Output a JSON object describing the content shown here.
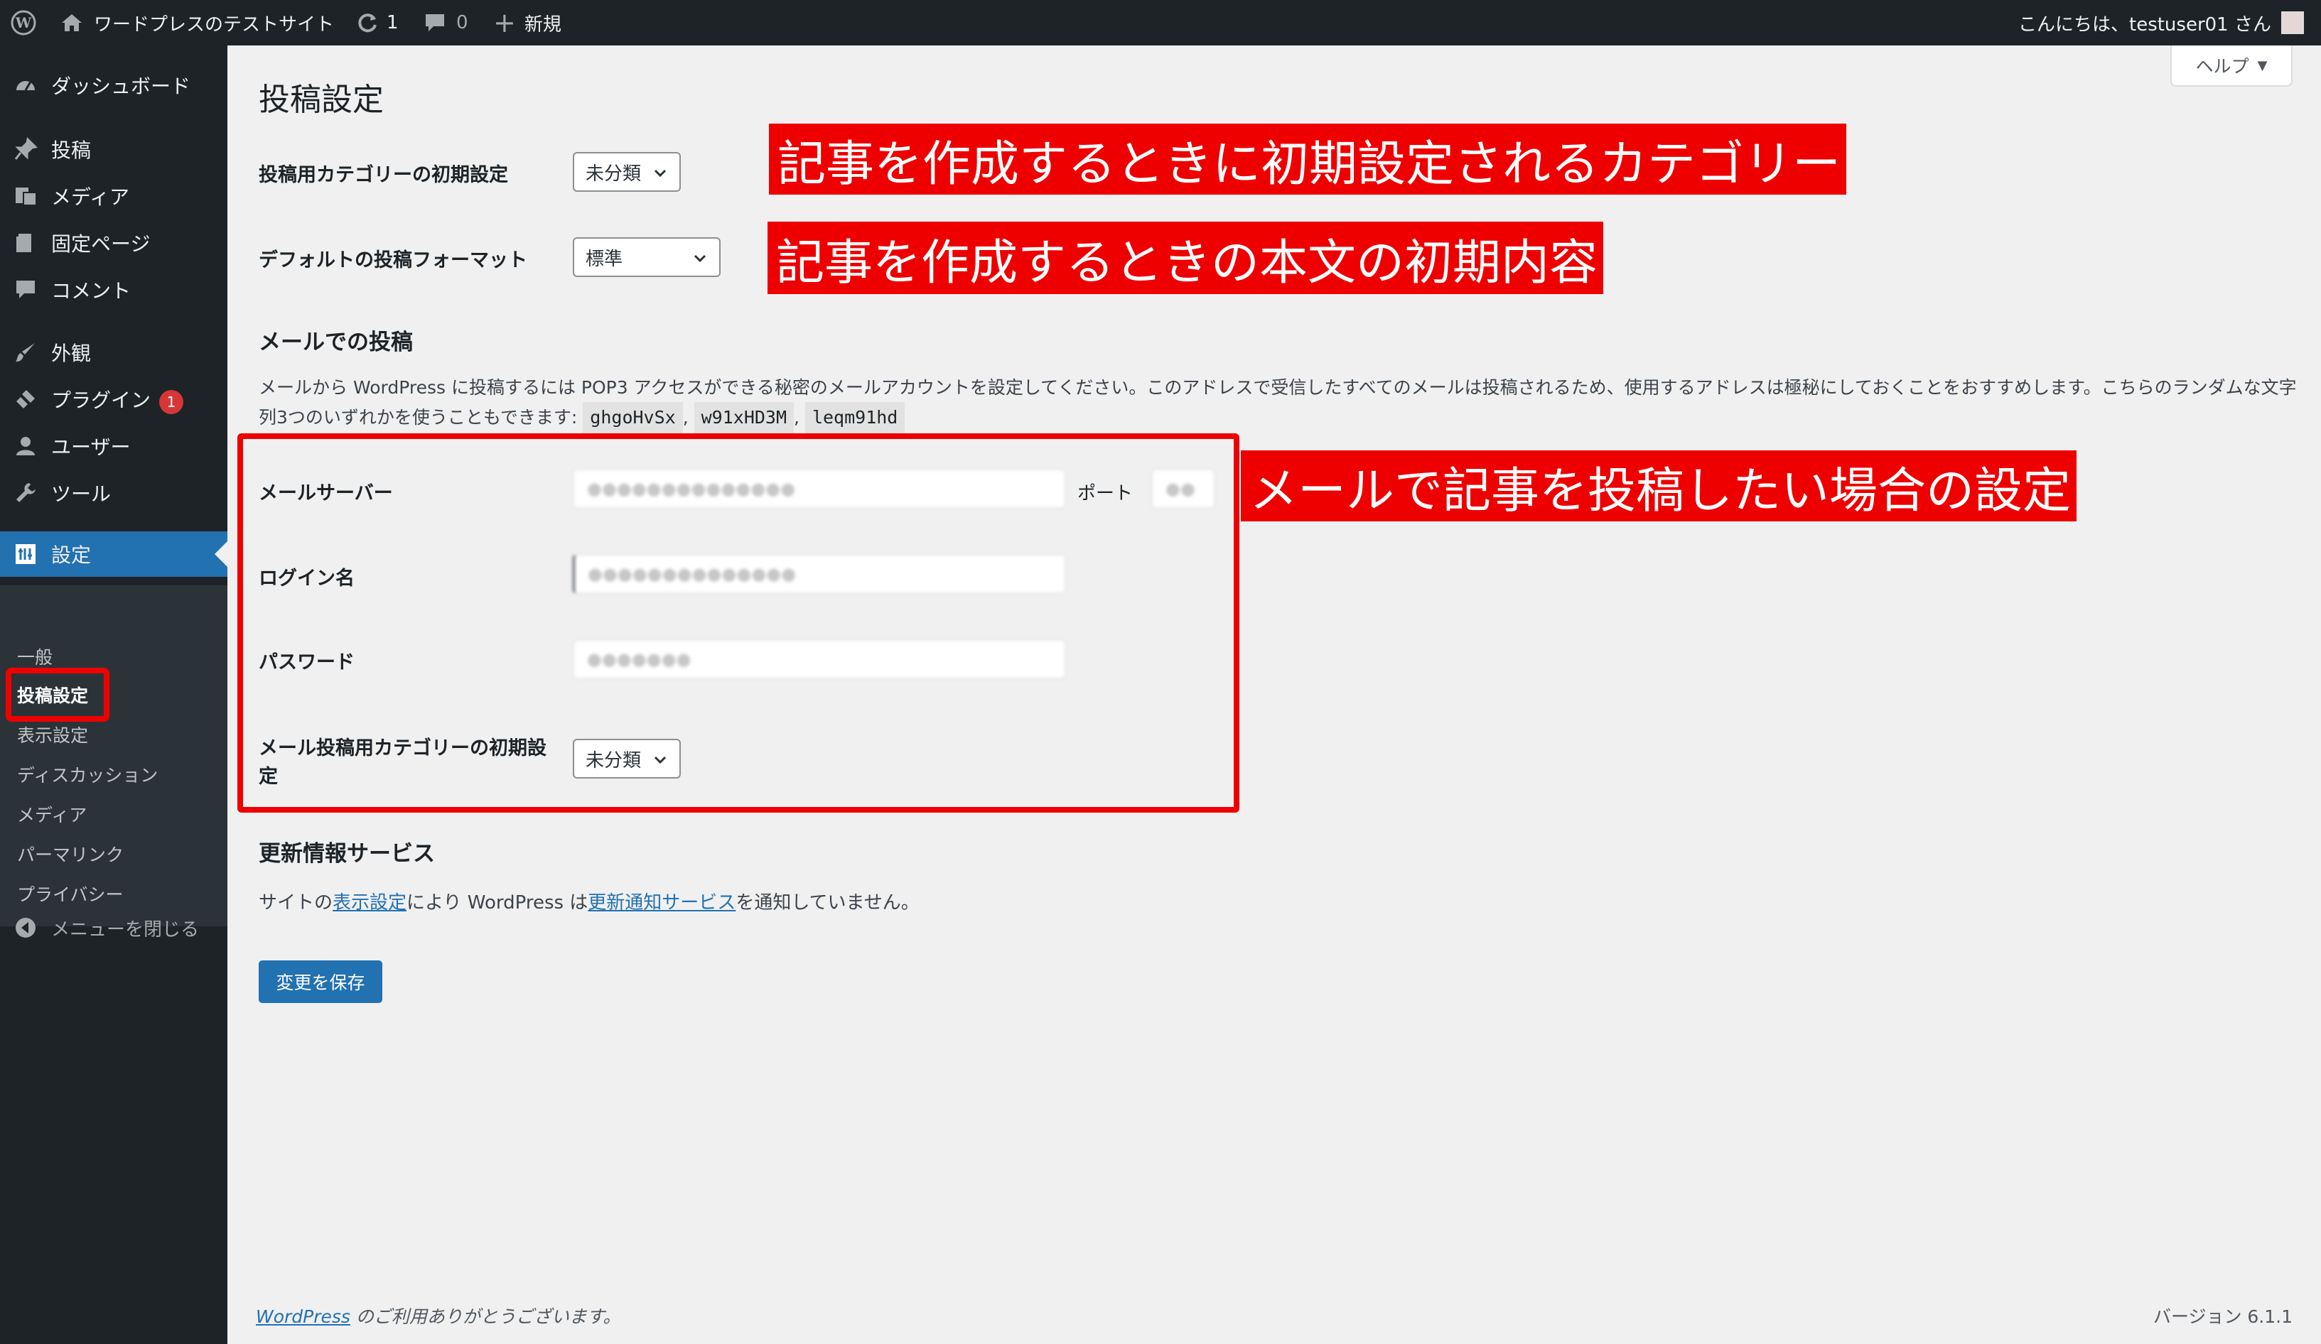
{
  "admin_bar": {
    "site_name": "ワードプレスのテストサイト",
    "updates_count": "1",
    "comments_count": "0",
    "new_label": "新規",
    "greeting": "こんにちは、testuser01 さん"
  },
  "sidebar": {
    "items": [
      {
        "label": "ダッシュボード",
        "icon": "dashboard-icon"
      },
      {
        "label": "投稿",
        "icon": "pin-icon"
      },
      {
        "label": "メディア",
        "icon": "media-icon"
      },
      {
        "label": "固定ページ",
        "icon": "page-icon"
      },
      {
        "label": "コメント",
        "icon": "comment-icon"
      },
      {
        "label": "外観",
        "icon": "brush-icon"
      },
      {
        "label": "プラグイン",
        "icon": "plugin-icon",
        "badge": "1"
      },
      {
        "label": "ユーザー",
        "icon": "user-icon"
      },
      {
        "label": "ツール",
        "icon": "wrench-icon"
      },
      {
        "label": "設定",
        "icon": "settings-icon",
        "current": true
      }
    ],
    "submenu": [
      "一般",
      "投稿設定",
      "表示設定",
      "ディスカッション",
      "メディア",
      "パーマリンク",
      "プライバシー"
    ],
    "submenu_current": "投稿設定",
    "collapse_label": "メニューを閉じる"
  },
  "help_label": "ヘルプ",
  "page": {
    "title": "投稿設定",
    "default_category_label": "投稿用カテゴリーの初期設定",
    "default_category_value": "未分類",
    "default_format_label": "デフォルトの投稿フォーマット",
    "default_format_value": "標準",
    "post_via_email_heading": "メールでの投稿",
    "post_via_email_desc": "メールから WordPress に投稿するには POP3 アクセスができる秘密のメールアカウントを設定してください。このアドレスで受信したすべてのメールは投稿されるため、使用するアドレスは極秘にしておくことをおすすめします。こちらのランダムな文字列3つのいずれかを使うこともできます:",
    "random_strings": [
      "ghgoHvSx",
      "w91xHD3M",
      "leqm91hd"
    ],
    "mail_server_label": "メールサーバー",
    "port_label": "ポート",
    "login_name_label": "ログイン名",
    "password_label": "パスワード",
    "mail_category_label": "メール投稿用カテゴリーの初期設定",
    "mail_category_value": "未分類",
    "update_services_heading": "更新情報サービス",
    "update_services_text_1": "サイトの",
    "update_services_link_1": "表示設定",
    "update_services_text_2": "により WordPress は",
    "update_services_link_2": "更新通知サービス",
    "update_services_text_3": "を通知していません。",
    "save_button": "変更を保存"
  },
  "annotations": {
    "note_category": "記事を作成するときに初期設定されるカテゴリー",
    "note_format": "記事を作成するときの本文の初期内容",
    "note_mail": "メールで記事を投稿したい場合の設定"
  },
  "footer": {
    "thanks_link": "WordPress",
    "thanks_text": " のご利用ありがとうございます。",
    "version": "バージョン 6.1.1"
  },
  "colors": {
    "admin_bar": "#1d2327",
    "sidebar": "#1d2327",
    "accent": "#2271b1",
    "annotation": "#ee0000"
  }
}
